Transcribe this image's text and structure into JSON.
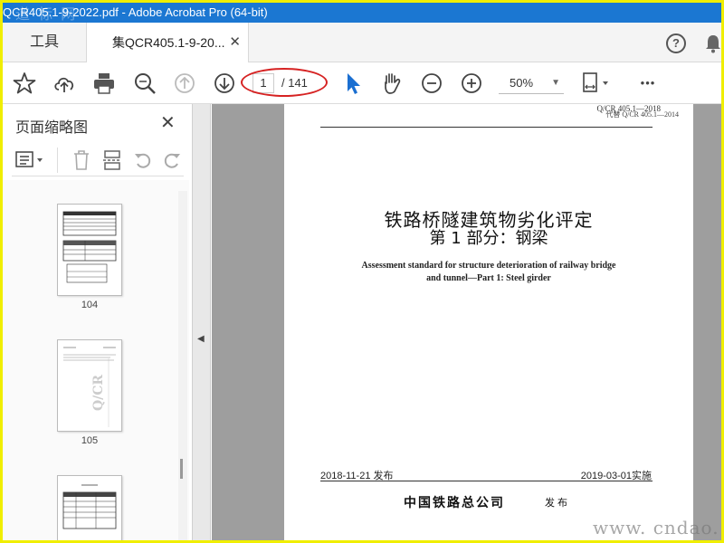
{
  "window": {
    "title": "QCR405.1-9-2022.pdf - Adobe Acrobat Pro (64-bit)",
    "watermark_top": "道 标 网"
  },
  "tabs": {
    "tools_label": "工具",
    "doc_label": "集QCR405.1-9-20...",
    "close_glyph": "✕",
    "help_glyph": "?"
  },
  "toolbar": {
    "current_page": "1",
    "total_pages": "/ 141",
    "zoom": "50%",
    "more_glyph": "•••"
  },
  "sidebar": {
    "title": "页面缩略图",
    "close_glyph": "✕",
    "thumbnails": [
      {
        "label": "104"
      },
      {
        "label": "105"
      },
      {
        "label": ""
      }
    ]
  },
  "document": {
    "std_code": "Q/CR 405.1—2018",
    "replaces": "代替 Q/CR 405.1—2014",
    "title_cn_1": "铁路桥隧建筑物劣化评定",
    "title_cn_2": "第 1 部分：钢梁",
    "title_en_1": "Assessment standard for structure deterioration of railway bridge",
    "title_en_2": "and tunnel—Part 1: Steel girder",
    "issue_date": "2018-11-21 发布",
    "impl_date": "2019-03-01实施",
    "publisher": "中国铁路总公司",
    "publish_word": "发 布"
  },
  "watermark_bottom": "www. cndao. c",
  "colors": {
    "title_bar": "#1b77d2",
    "border": "#f0ee00",
    "annotation": "#d62222",
    "select_tool": "#1b6fd1"
  }
}
